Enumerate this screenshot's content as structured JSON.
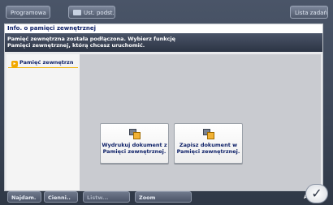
{
  "toolbar": {
    "programs_label": "Programowa",
    "settings_label": "Ust. podst.",
    "job_list_label": "Lista zadań"
  },
  "dialog": {
    "title": "Info. o pamięci zewnętrznej",
    "message_line1": "Pamięć zewnętrzna została podłączona. Wybierz funkcję",
    "message_line2": "Pamięci zewnętrznej, którą chcesz uruchomić.",
    "sidebar_item": "Pamięć zewnętrzn",
    "actions": [
      {
        "label_line1": "Wydrukuj dokument z",
        "label_line2": "Pamięci zewnętrznej.",
        "icon": "print-from-memory-icon"
      },
      {
        "label_line1": "Zapisz dokument w",
        "label_line2": "Pamięci zewnętrznej.",
        "icon": "save-to-memory-icon"
      }
    ]
  },
  "bottombar": {
    "btn1": "Najdam.",
    "btn2": "Cienni..",
    "btn3": "Listw...",
    "zoom_label": "Zoom"
  },
  "ok_label": "✓",
  "ok_prefix": "A"
}
